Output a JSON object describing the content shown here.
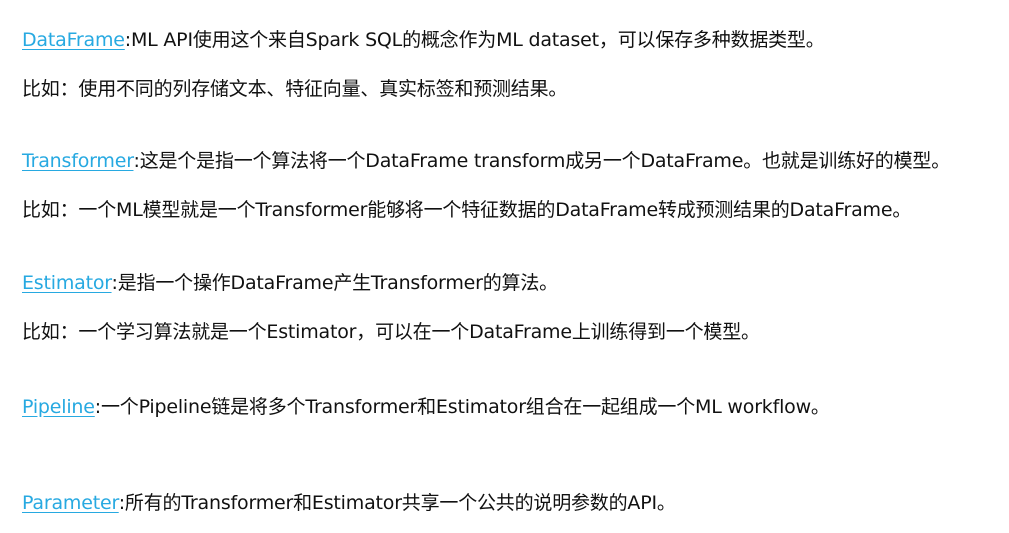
{
  "entries": [
    {
      "term": "DataFrame",
      "definition": "ML API使用这个来自Spark SQL的概念作为ML dataset，可以保存多种数据类型。",
      "example": "比如：使用不同的列存储文本、特征向量、真实标签和预测结果。"
    },
    {
      "term": "Transformer",
      "definition": "这是个是指一个算法将一个DataFrame transform成另一个DataFrame。也就是训练好的模型。",
      "example": "比如：一个ML模型就是一个Transformer能够将一个特征数据的DataFrame转成预测结果的DataFrame。"
    },
    {
      "term": "Estimator",
      "definition": "是指一个操作DataFrame产生Transformer的算法。",
      "example": "比如：一个学习算法就是一个Estimator，可以在一个DataFrame上训练得到一个模型。"
    },
    {
      "term": "Pipeline",
      "definition": "一个Pipeline链是将多个Transformer和Estimator组合在一起组成一个ML workflow。"
    },
    {
      "term": "Parameter",
      "definition": "所有的Transformer和Estimator共享一个公共的说明参数的API。"
    }
  ],
  "colors": {
    "link": "#27a9e1",
    "text": "#111111",
    "background": "#ffffff"
  }
}
